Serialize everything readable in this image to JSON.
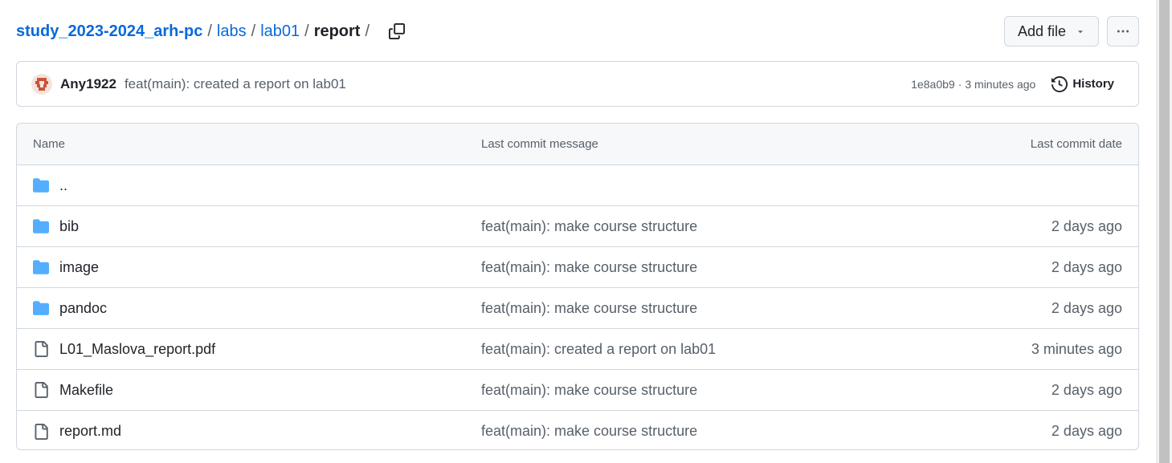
{
  "breadcrumb": {
    "repo": "study_2023-2024_arh-pc",
    "sep": "/",
    "path": [
      "labs",
      "lab01"
    ],
    "current": "report"
  },
  "actions": {
    "add_file_label": "Add file",
    "more_label": "···"
  },
  "commit": {
    "author": "Any1922",
    "message": "feat(main): created a report on lab01",
    "sha": "1e8a0b9",
    "dot": "·",
    "time": "3 minutes ago",
    "history_label": "History"
  },
  "table": {
    "headers": {
      "name": "Name",
      "message": "Last commit message",
      "date": "Last commit date"
    },
    "rows": [
      {
        "type": "folder",
        "name": "..",
        "message": "",
        "date": ""
      },
      {
        "type": "folder",
        "name": "bib",
        "message": "feat(main): make course structure",
        "date": "2 days ago"
      },
      {
        "type": "folder",
        "name": "image",
        "message": "feat(main): make course structure",
        "date": "2 days ago"
      },
      {
        "type": "folder",
        "name": "pandoc",
        "message": "feat(main): make course structure",
        "date": "2 days ago"
      },
      {
        "type": "file",
        "name": "L01_Maslova_report.pdf",
        "message": "feat(main): created a report on lab01",
        "date": "3 minutes ago"
      },
      {
        "type": "file",
        "name": "Makefile",
        "message": "feat(main): make course structure",
        "date": "2 days ago"
      },
      {
        "type": "file",
        "name": "report.md",
        "message": "feat(main): make course structure",
        "date": "2 days ago"
      }
    ]
  },
  "colors": {
    "link": "#0969da",
    "folder": "#54aeff",
    "muted": "#57606a",
    "border": "#d0d7de"
  }
}
